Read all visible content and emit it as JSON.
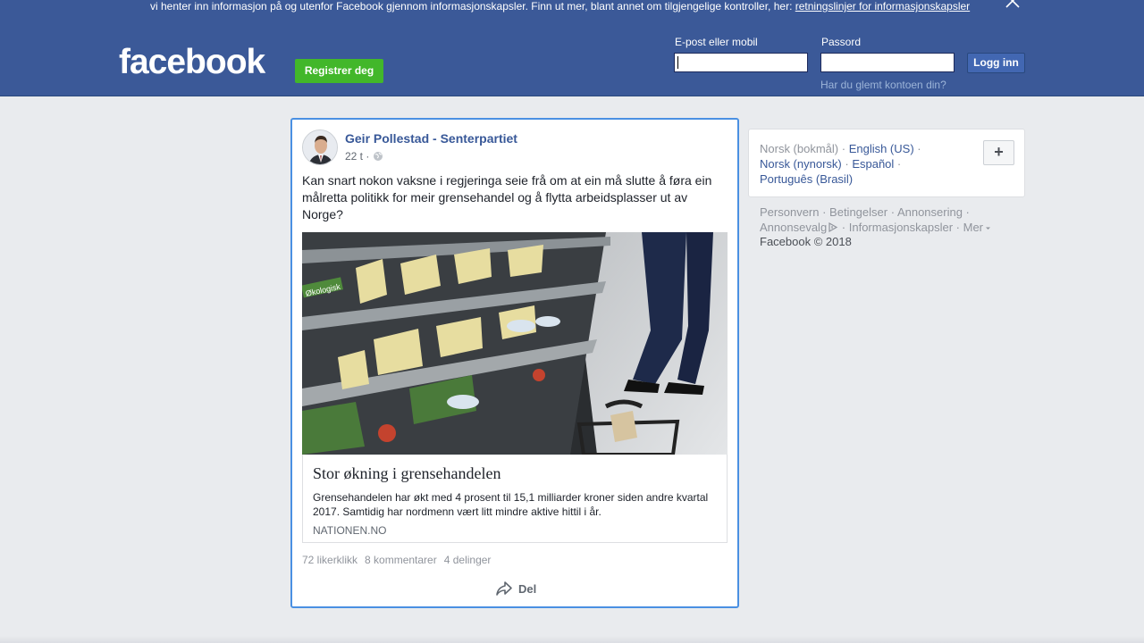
{
  "cookie_bar": {
    "text": "vi henter inn informasjon på og utenfor Facebook gjennom informasjonskapsler. Finn ut mer, blant annet om tilgjengelige kontroller, her: ",
    "link": "retningslinjer for informasjonskapsler"
  },
  "header": {
    "logo": "facebook",
    "register_label": "Registrer deg",
    "email_label": "E-post eller mobil",
    "password_label": "Passord",
    "login_label": "Logg inn",
    "forgot_label": "Har du glemt kontoen din?"
  },
  "post": {
    "author": "Geir Pollestad - Senterpartiet",
    "time": "22 t ·",
    "text": "Kan snart nokon vaksne i regjeringa seie frå om at ein må slutte å føra ein målretta politikk for meir grensehandel og å flytta arbeidsplasser ut av Norge?",
    "link": {
      "title": "Stor økning i grensehandelen",
      "description": "Grensehandelen har økt med 4 prosent til 15,1 milliarder kroner siden andre kvartal 2017. Samtidig har nordmenn vært litt mindre aktive hittil i år.",
      "source": "NATIONEN.NO"
    },
    "stats": {
      "likes": "72 likerklikk",
      "comments": "8 kommentarer",
      "shares": "4 delinger"
    },
    "share_label": "Del",
    "photo_shelf_label": "Økologisk"
  },
  "languages": {
    "current": "Norsk (bokmål)",
    "sep": " · ",
    "options": [
      "English (US)",
      "Norsk (nynorsk)",
      "Español",
      "Português (Brasil)"
    ],
    "more_label": "+"
  },
  "footer": {
    "links": [
      "Personvern",
      "Betingelser",
      "Annonsering",
      "Annonsevalg",
      "Informasjonskapsler",
      "Mer"
    ],
    "copyright": "Facebook © 2018"
  },
  "colors": {
    "brand": "#3b5998",
    "register_green": "#42b72a",
    "link_blue": "#385898",
    "focus_border": "#4a90e2"
  }
}
